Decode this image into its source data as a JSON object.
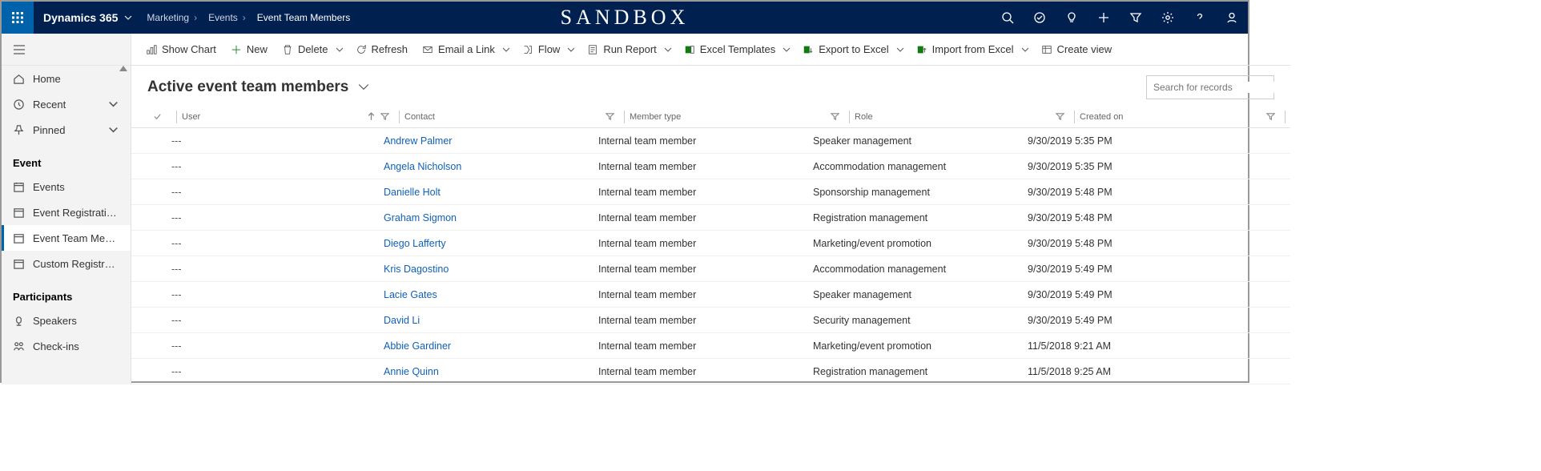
{
  "header": {
    "brand": "Dynamics 365",
    "app": "Marketing",
    "crumb1": "Events",
    "crumb2": "Event Team Members",
    "env": "SANDBOX"
  },
  "sidebar": {
    "home": "Home",
    "recent": "Recent",
    "pinned": "Pinned",
    "group_event": "Event",
    "events": "Events",
    "eventreg": "Event Registratio…",
    "eventteam": "Event Team Mem…",
    "customreg": "Custom Registrat…",
    "group_participants": "Participants",
    "speakers": "Speakers",
    "checkins": "Check-ins"
  },
  "cmd": {
    "show_chart": "Show Chart",
    "new": "New",
    "delete": "Delete",
    "refresh": "Refresh",
    "email": "Email a Link",
    "flow": "Flow",
    "run_report": "Run Report",
    "excel_tmpl": "Excel Templates",
    "export_excel": "Export to Excel",
    "import_excel": "Import from Excel",
    "create_view": "Create view"
  },
  "view": {
    "title": "Active event team members",
    "search_placeholder": "Search for records"
  },
  "cols": {
    "user": "User",
    "contact": "Contact",
    "mtype": "Member type",
    "role": "Role",
    "created": "Created on"
  },
  "rows": [
    {
      "user": "---",
      "contact": "Andrew Palmer",
      "mtype": "Internal team member",
      "role": "Speaker management",
      "created": "9/30/2019 5:35 PM"
    },
    {
      "user": "---",
      "contact": "Angela Nicholson",
      "mtype": "Internal team member",
      "role": "Accommodation management",
      "created": "9/30/2019 5:35 PM"
    },
    {
      "user": "---",
      "contact": "Danielle Holt",
      "mtype": "Internal team member",
      "role": "Sponsorship management",
      "created": "9/30/2019 5:48 PM"
    },
    {
      "user": "---",
      "contact": "Graham Sigmon",
      "mtype": "Internal team member",
      "role": "Registration management",
      "created": "9/30/2019 5:48 PM"
    },
    {
      "user": "---",
      "contact": "Diego Lafferty",
      "mtype": "Internal team member",
      "role": "Marketing/event promotion",
      "created": "9/30/2019 5:48 PM"
    },
    {
      "user": "---",
      "contact": "Kris Dagostino",
      "mtype": "Internal team member",
      "role": "Accommodation management",
      "created": "9/30/2019 5:49 PM"
    },
    {
      "user": "---",
      "contact": "Lacie Gates",
      "mtype": "Internal team member",
      "role": "Speaker management",
      "created": "9/30/2019 5:49 PM"
    },
    {
      "user": "---",
      "contact": "David Li",
      "mtype": "Internal team member",
      "role": "Security management",
      "created": "9/30/2019 5:49 PM"
    },
    {
      "user": "---",
      "contact": "Abbie Gardiner",
      "mtype": "Internal team member",
      "role": "Marketing/event promotion",
      "created": "11/5/2018 9:21 AM"
    },
    {
      "user": "---",
      "contact": "Annie Quinn",
      "mtype": "Internal team member",
      "role": "Registration management",
      "created": "11/5/2018 9:25 AM"
    }
  ]
}
